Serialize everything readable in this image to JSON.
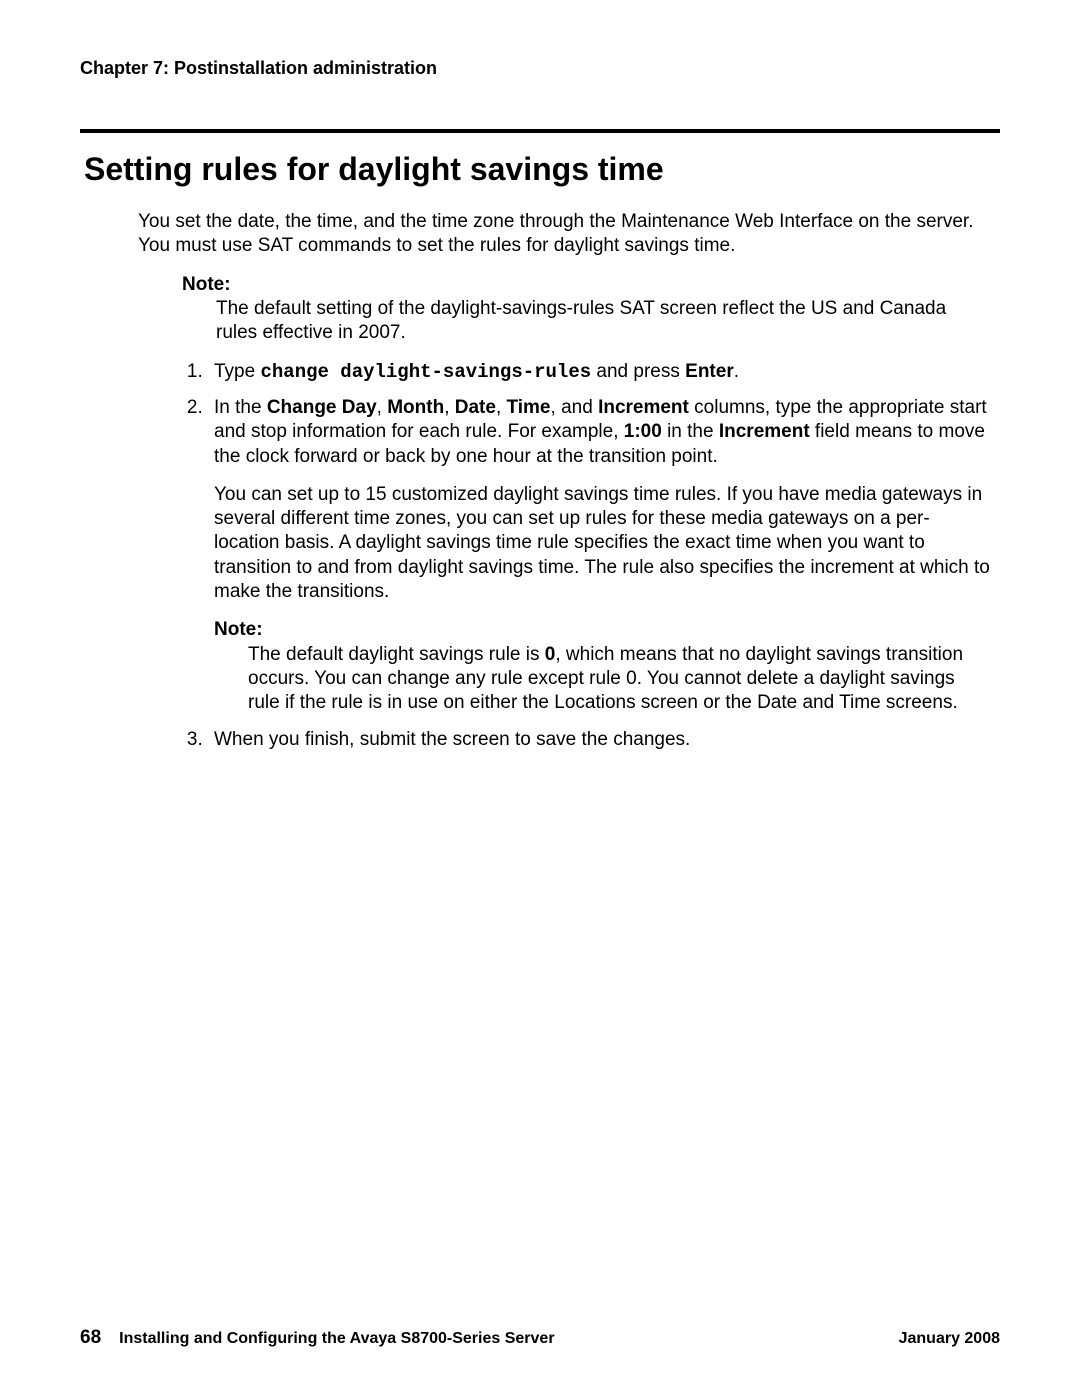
{
  "header": {
    "chapter": "Chapter 7: Postinstallation administration"
  },
  "title": "Setting rules for daylight savings time",
  "intro": "You set the date, the time, and the time zone through the Maintenance Web Interface on the server. You must use SAT commands to set the rules for daylight savings time.",
  "note1": {
    "label": "Note:",
    "text": "The default setting of the daylight-savings-rules SAT screen reflect the US and Canada rules effective in 2007."
  },
  "steps": {
    "s1": {
      "pre": "Type ",
      "cmd": "change daylight-savings-rules",
      "mid": " and press ",
      "key": "Enter",
      "post": "."
    },
    "s2": {
      "lead": "In the ",
      "f1": "Change Day",
      "c": ", ",
      "f2": "Month",
      "f3": "Date",
      "f4": "Time",
      "and": ", and ",
      "f5": "Increment",
      "after_fields": " columns, type the appropriate start and stop information for each rule. For example, ",
      "val": "1:00",
      "after_val": " in the ",
      "f6": "Increment",
      "tail": " field means to move the clock forward or back by one hour at the transition point.",
      "para2": "You can set up to 15 customized daylight savings time rules. If you have media gateways in several different time zones, you can set up rules for these media gateways on a per-location basis. A daylight savings time rule specifies the exact time when you want to transition to and from daylight savings time. The rule also specifies the increment at which to make the transitions.",
      "note": {
        "label": "Note:",
        "pre": "The default daylight savings rule is ",
        "zero": "0",
        "post": ", which means that no daylight savings transition occurs. You can change any rule except rule 0. You cannot delete a daylight savings rule if the rule is in use on either the Locations screen or the Date and Time screens."
      }
    },
    "s3": "When you finish, submit the screen to save the changes."
  },
  "footer": {
    "page": "68",
    "doc": "Installing and Configuring the Avaya S8700-Series Server",
    "date": "January 2008"
  }
}
